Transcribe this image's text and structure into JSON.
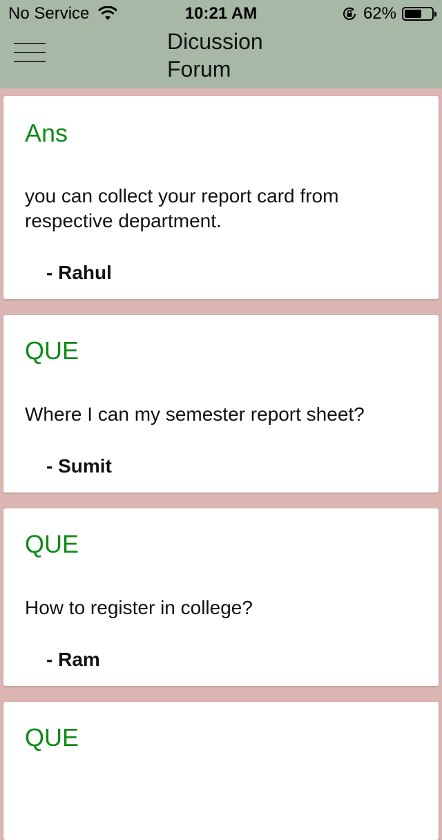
{
  "status_bar": {
    "carrier": "No Service",
    "time": "10:21 AM",
    "battery_percent": "62%",
    "battery_level": 0.62,
    "wifi_icon": "wifi-icon",
    "rotation_lock_icon": "rotation-lock-icon"
  },
  "header": {
    "title_line1": "Dicussion",
    "title_line2": "Forum",
    "menu_icon": "hamburger-menu-icon",
    "background": "#a8b8a7"
  },
  "colors": {
    "tag": "#0f8a18",
    "background": "#dcb6b2"
  },
  "posts": [
    {
      "tag": "Ans",
      "text": "you can collect your report card from respective department.",
      "author": "- Rahul"
    },
    {
      "tag": "QUE",
      "text": "Where I can my semester report sheet?",
      "author": "- Sumit"
    },
    {
      "tag": "QUE",
      "text": "How to register in college?",
      "author": "- Ram"
    },
    {
      "tag": "QUE",
      "text": "",
      "author": ""
    }
  ]
}
